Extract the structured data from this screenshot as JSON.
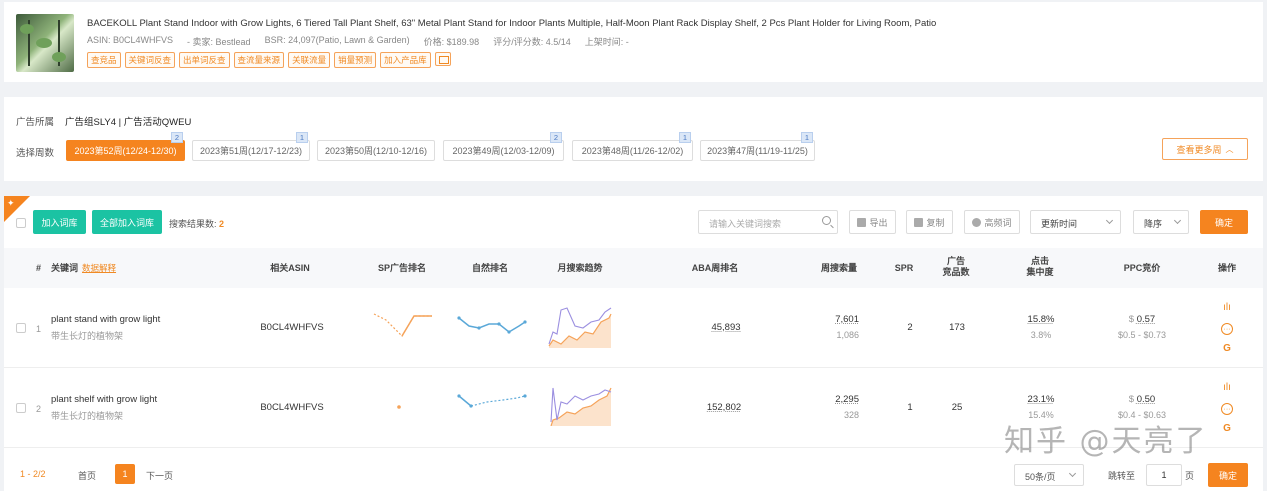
{
  "product": {
    "title": "BACEKOLL Plant Stand Indoor with Grow Lights, 6 Tiered Tall Plant Shelf, 63\" Metal Plant Stand for Indoor Plants Multiple, Half-Moon Plant Rack Display Shelf, 2 Pcs Plant Holder for Living Room, Patio",
    "asin": "ASIN: B0CL4WHFVS",
    "seller": "- 卖家: Bestlead",
    "bsr": "BSR: 24,097(Patio, Lawn & Garden)",
    "price": "价格: $189.98",
    "rating": "评分/评分数: 4.5/14",
    "launch": "上架时间: -",
    "tags": [
      "查竞品",
      "关键词反查",
      "出单词反查",
      "查流量来源",
      "关联流量",
      "销量预测",
      "加入产品库"
    ],
    "tag_icon": "table-icon"
  },
  "adinfo": {
    "belong_label": "广告所属",
    "belong_value": "广告组SLY4 | 广告活动QWEU",
    "weeks_label": "选择周数",
    "weeks": [
      {
        "label": "2023第52周(12/24-12/30)",
        "badge": "2",
        "active": true
      },
      {
        "label": "2023第51周(12/17-12/23)",
        "badge": "1",
        "active": false
      },
      {
        "label": "2023第50周(12/10-12/16)",
        "badge": "",
        "active": false
      },
      {
        "label": "2023第49周(12/03-12/09)",
        "badge": "2",
        "active": false
      },
      {
        "label": "2023第48周(11/26-12/02)",
        "badge": "1",
        "active": false
      },
      {
        "label": "2023第47周(11/19-11/25)",
        "badge": "1",
        "active": false
      }
    ],
    "more_weeks": "查看更多周"
  },
  "toolbar": {
    "add_lib": "加入词库",
    "add_all_lib": "全部加入词库",
    "count_label": "搜索结果数:",
    "count": "2",
    "search_placeholder": "请输入关键词搜索",
    "export": "导出",
    "copy": "复制",
    "high_freq": "高频词",
    "sort_field": "更新时间",
    "sort_order": "降序",
    "confirm": "确定"
  },
  "table": {
    "headers": {
      "index": "#",
      "keyword": "关键词",
      "data_explain": "数据解释",
      "asin": "相关ASIN",
      "sp_rank": "SP广告排名",
      "organic_rank": "自然排名",
      "trend": "月搜索趋势",
      "aba_rank": "ABA周排名",
      "weekly_search": "周搜索量",
      "spr": "SPR",
      "ad_products_1": "广告",
      "ad_products_2": "竞品数",
      "click_conc_1": "点击",
      "click_conc_2": "集中度",
      "ppc": "PPC竞价",
      "ops": "操作"
    },
    "rows": [
      {
        "index": "1",
        "keyword": "plant stand with grow light",
        "translation": "带生长灯的植物架",
        "asin": "B0CL4WHFVS",
        "aba_rank": "45,893",
        "weekly_search": "7,601",
        "weekly_search_sub": "1,086",
        "spr": "2",
        "ad_products": "173",
        "click_conc": "15.8%",
        "click_conc_sub": "3.8%",
        "ppc_symbol": "$",
        "ppc": "0.57",
        "ppc_range": "$0.5 - $0.73"
      },
      {
        "index": "2",
        "keyword": "plant shelf with grow light",
        "translation": "带生长灯的植物架",
        "asin": "B0CL4WHFVS",
        "aba_rank": "152,802",
        "weekly_search": "2,295",
        "weekly_search_sub": "328",
        "spr": "1",
        "ad_products": "25",
        "click_conc": "23.1%",
        "click_conc_sub": "15.4%",
        "ppc_symbol": "$",
        "ppc": "0.50",
        "ppc_range": "$0.4 - $0.63"
      }
    ]
  },
  "pager": {
    "range": "1 - 2/2",
    "first": "首页",
    "current": "1",
    "next": "下一页",
    "page_size": "50条/页",
    "goto_label": "跳转至",
    "goto_value": "1",
    "page_unit": "页",
    "confirm": "确定"
  },
  "watermark": "知乎 @天亮了",
  "colors": {
    "accent": "#f5841f",
    "green": "#1bc3a3",
    "line_orange": "#f5a35a",
    "line_blue": "#5aa8d8"
  }
}
